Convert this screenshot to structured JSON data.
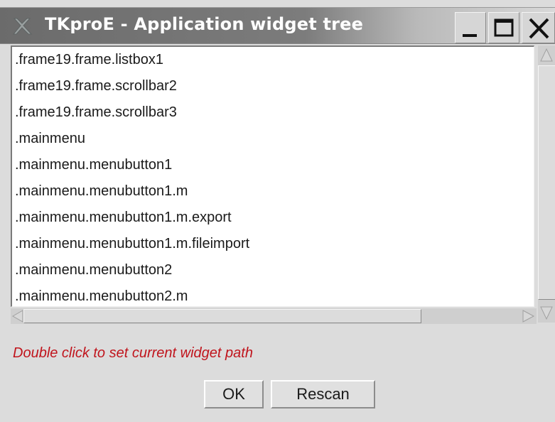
{
  "window": {
    "title": "TKproE - Application widget tree",
    "controls": {
      "minimize_icon": "minimize-icon",
      "maximize_icon": "maximize-icon",
      "close_icon": "close-icon"
    }
  },
  "listbox": {
    "items": [
      ".frame19.frame.listbox1",
      ".frame19.frame.scrollbar2",
      ".frame19.frame.scrollbar3",
      ".mainmenu",
      ".mainmenu.menubutton1",
      ".mainmenu.menubutton1.m",
      ".mainmenu.menubutton1.m.export",
      ".mainmenu.menubutton1.m.fileimport",
      ".mainmenu.menubutton2",
      ".mainmenu.menubutton2.m"
    ]
  },
  "status": {
    "hint": "Double click to set current widget path",
    "color": "#c0141c"
  },
  "buttons": {
    "ok_label": "OK",
    "rescan_label": "Rescan"
  }
}
